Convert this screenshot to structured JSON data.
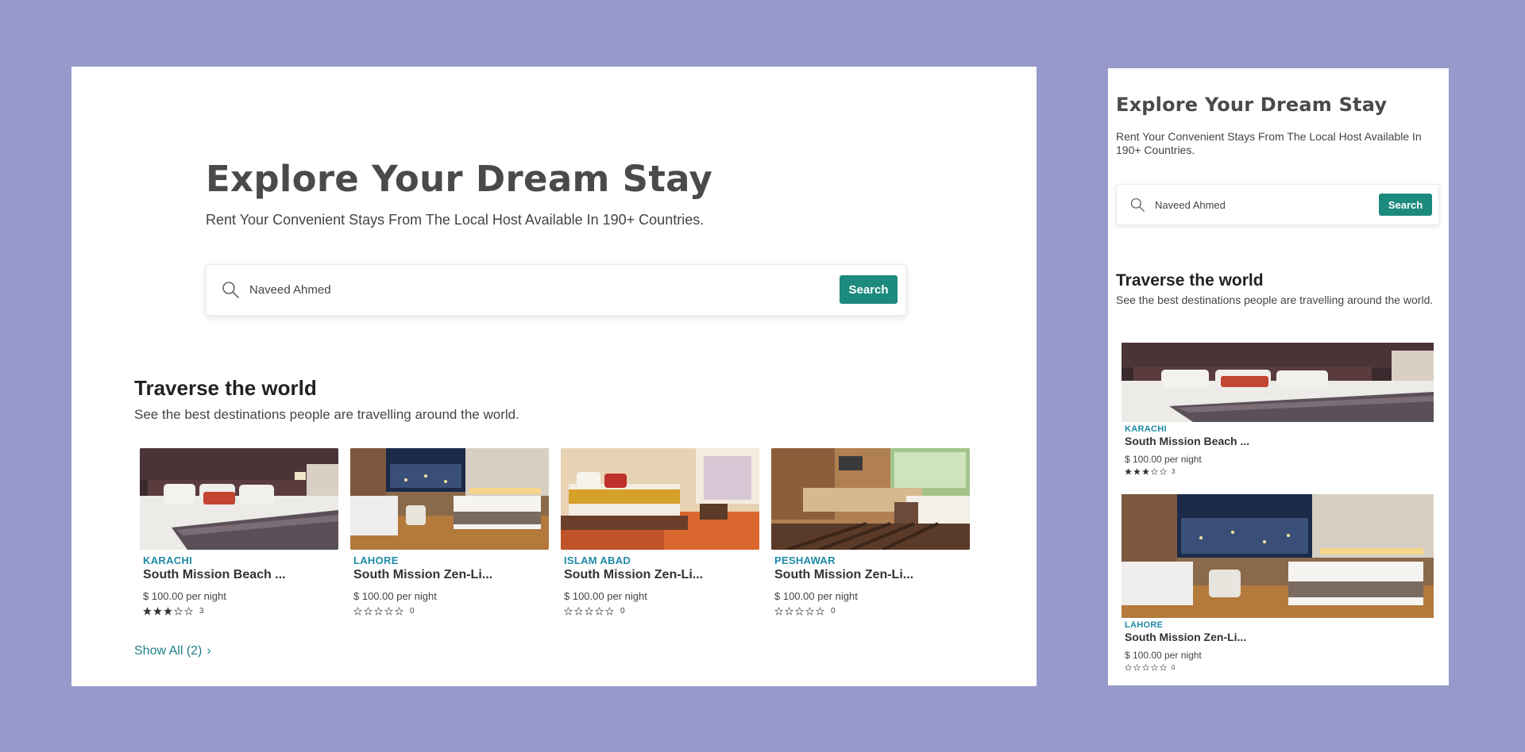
{
  "colors": {
    "background": "#9899cb",
    "accent": "#1d8a7e",
    "city": "#1f8aa6",
    "link": "#1d7f8a"
  },
  "hero": {
    "title": "Explore Your Dream Stay",
    "subtitle": "Rent Your Convenient Stays From The Local Host Available In 190+ Countries.",
    "search_value": "Naveed Ahmed",
    "search_button": "Search"
  },
  "section": {
    "title": "Traverse the world",
    "description": "See the best destinations people are travelling around the world."
  },
  "cards": [
    {
      "city": "KARACHI",
      "name": "South Mission Beach ...",
      "price": "$ 100.00 per night",
      "rating": 3,
      "rating_max": 5,
      "review_count": "3",
      "image": "hotel-room-purple"
    },
    {
      "city": "LAHORE",
      "name": "South Mission Zen-Li...",
      "price": "$ 100.00 per night",
      "rating": 0,
      "rating_max": 5,
      "review_count": "0",
      "image": "hotel-room-city-view"
    },
    {
      "city": "ISLAM ABAD",
      "name": "South Mission Zen-Li...",
      "price": "$ 100.00 per night",
      "rating": 0,
      "rating_max": 5,
      "review_count": "0",
      "image": "hotel-room-gold"
    },
    {
      "city": "PESHAWAR",
      "name": "South Mission Zen-Li...",
      "price": "$ 100.00 per night",
      "rating": 0,
      "rating_max": 5,
      "review_count": "0",
      "image": "hotel-room-striped"
    }
  ],
  "show_all": "Show All (2)"
}
